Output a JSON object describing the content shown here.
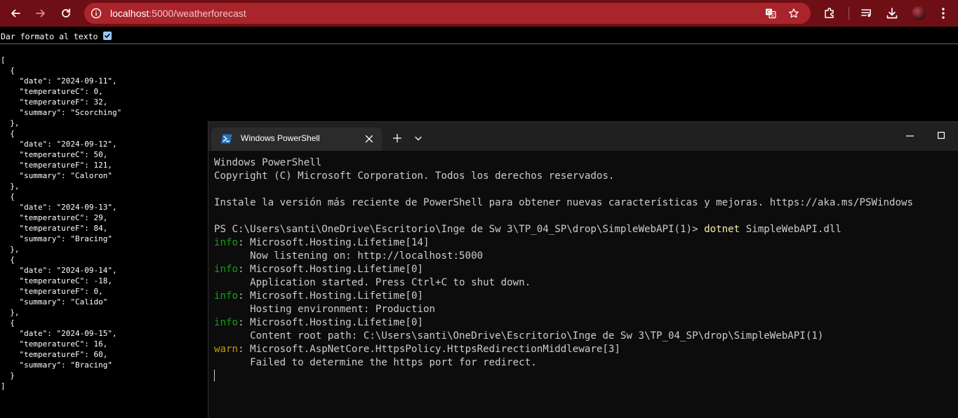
{
  "browser": {
    "url_host": "localhost",
    "url_path": ":5000/weatherforecast",
    "icons": {
      "back": "arrow-left-icon",
      "forward": "arrow-right-icon",
      "reload": "reload-icon",
      "site_info": "site-info-icon",
      "translate": "translate-icon",
      "bookmark": "star-icon",
      "extensions": "puzzle-icon",
      "media": "media-queue-icon",
      "downloads": "download-icon",
      "profile": "avatar",
      "menu": "kebab-menu-icon"
    },
    "colors": {
      "toolbar": "#6d0f14",
      "omnibox": "#a9242b"
    }
  },
  "prettyprint": {
    "label": "Dar formato al texto",
    "checked": true
  },
  "json_lines": [
    "[",
    "  {",
    "    \"date\": \"2024-09-11\",",
    "    \"temperatureC\": 0,",
    "    \"temperatureF\": 32,",
    "    \"summary\": \"Scorching\"",
    "  },",
    "  {",
    "    \"date\": \"2024-09-12\",",
    "    \"temperatureC\": 50,",
    "    \"temperatureF\": 121,",
    "    \"summary\": \"Caloron\"",
    "  },",
    "  {",
    "    \"date\": \"2024-09-13\",",
    "    \"temperatureC\": 29,",
    "    \"temperatureF\": 84,",
    "    \"summary\": \"Bracing\"",
    "  },",
    "  {",
    "    \"date\": \"2024-09-14\",",
    "    \"temperatureC\": -18,",
    "    \"temperatureF\": 0,",
    "    \"summary\": \"Calido\"",
    "  },",
    "  {",
    "    \"date\": \"2024-09-15\",",
    "    \"temperatureC\": 16,",
    "    \"temperatureF\": 60,",
    "    \"summary\": \"Bracing\"",
    "  }",
    "]"
  ],
  "terminal": {
    "tab_title": "Windows PowerShell",
    "lines": [
      {
        "parts": [
          {
            "t": "Windows PowerShell"
          }
        ]
      },
      {
        "parts": [
          {
            "t": "Copyright (C) Microsoft Corporation. Todos los derechos reservados."
          }
        ]
      },
      {
        "parts": [
          {
            "t": ""
          }
        ]
      },
      {
        "parts": [
          {
            "t": "Instale la versión más reciente de PowerShell para obtener nuevas características y mejoras. https://aka.ms/PSWindows"
          }
        ]
      },
      {
        "parts": [
          {
            "t": ""
          }
        ]
      },
      {
        "parts": [
          {
            "t": "PS C:\\Users\\santi\\OneDrive\\Escritorio\\Inge de Sw 3\\TP_04_SP\\drop\\SimpleWebAPI(1)> "
          },
          {
            "t": "dotnet",
            "c": "cmd"
          },
          {
            "t": " SimpleWebAPI.dll"
          }
        ]
      },
      {
        "parts": [
          {
            "t": "info",
            "c": "info"
          },
          {
            "t": ": Microsoft.Hosting.Lifetime[14]"
          }
        ]
      },
      {
        "parts": [
          {
            "t": "      Now listening on: http://localhost:5000"
          }
        ]
      },
      {
        "parts": [
          {
            "t": "info",
            "c": "info"
          },
          {
            "t": ": Microsoft.Hosting.Lifetime[0]"
          }
        ]
      },
      {
        "parts": [
          {
            "t": "      Application started. Press Ctrl+C to shut down."
          }
        ]
      },
      {
        "parts": [
          {
            "t": "info",
            "c": "info"
          },
          {
            "t": ": Microsoft.Hosting.Lifetime[0]"
          }
        ]
      },
      {
        "parts": [
          {
            "t": "      Hosting environment: Production"
          }
        ]
      },
      {
        "parts": [
          {
            "t": "info",
            "c": "info"
          },
          {
            "t": ": Microsoft.Hosting.Lifetime[0]"
          }
        ]
      },
      {
        "parts": [
          {
            "t": "      Content root path: C:\\Users\\santi\\OneDrive\\Escritorio\\Inge de Sw 3\\TP_04_SP\\drop\\SimpleWebAPI(1)"
          }
        ]
      },
      {
        "parts": [
          {
            "t": "warn",
            "c": "warn"
          },
          {
            "t": ": Microsoft.AspNetCore.HttpsPolicy.HttpsRedirectionMiddleware[3]"
          }
        ]
      },
      {
        "parts": [
          {
            "t": "      Failed to determine the https port for redirect."
          }
        ]
      }
    ],
    "colors": {
      "info": "#13a10e",
      "warn": "#c19c00",
      "command": "#f9f1a5",
      "text": "#cccccc"
    },
    "icons": {
      "tab_icon": "powershell-icon",
      "close": "close-icon",
      "new_tab": "plus-icon",
      "dropdown": "chevron-down-icon",
      "minimize": "minimize-icon",
      "maximize": "maximize-icon"
    }
  }
}
